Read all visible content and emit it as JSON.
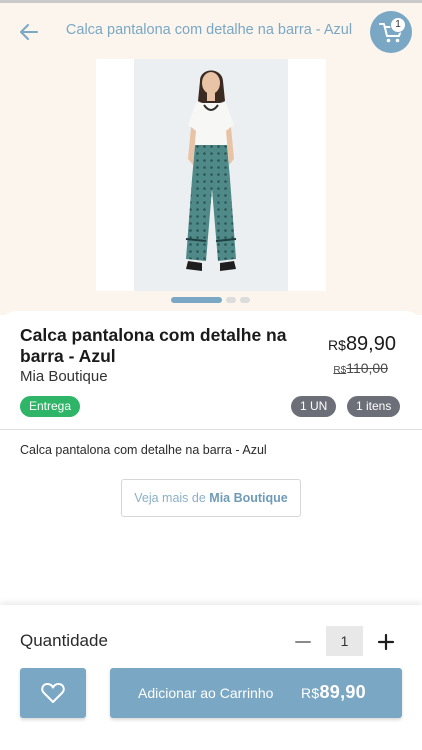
{
  "header": {
    "title": "Calca pantalona com detalhe na barra - Azul",
    "cart_count": "1"
  },
  "gallery": {
    "image_alt": "Calca pantalona com detalhe na barra - Azul",
    "slides": 3,
    "active_slide": 1
  },
  "product": {
    "name": "Calca pantalona com detalhe na barra - Azul",
    "store": "Mia Boutique",
    "currency": "R$",
    "price": "89,90",
    "old_price": "110,00",
    "delivery_badge": "Entrega",
    "unit_badge": "1 UN",
    "items_badge": "1 itens",
    "description": "Calca pantalona com detalhe na barra - Azul"
  },
  "see_more": {
    "prefix": "Veja mais de ",
    "store": "Mia Boutique"
  },
  "purchase": {
    "quantity_label": "Quantidade",
    "quantity": "1",
    "add_to_cart_label": "Adicionar ao Carrinho",
    "total_currency": "R$",
    "total": "89,90"
  },
  "colors": {
    "accent": "#7aa7c4",
    "delivery_green": "#2fb567",
    "badge_gray": "#6c6f78",
    "header_bg": "#fbf5ee"
  },
  "icons": {
    "back": "arrow-left-icon",
    "cart": "shopping-cart-icon",
    "favorite": "heart-outline-icon",
    "minus": "minus-icon",
    "plus": "plus-icon"
  }
}
